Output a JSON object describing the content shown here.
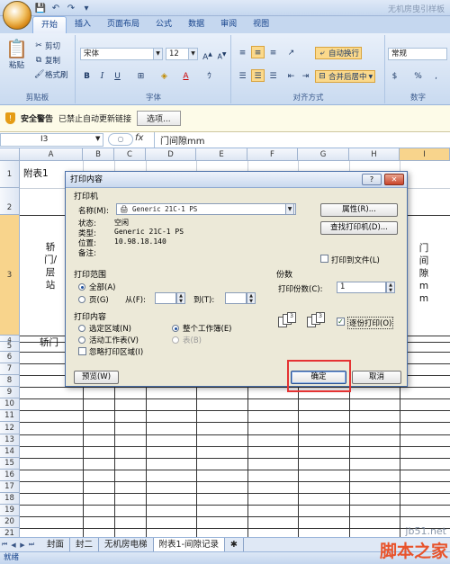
{
  "window": {
    "title": "无机房曳引样板"
  },
  "ribbon": {
    "tabs": [
      "开始",
      "插入",
      "页面布局",
      "公式",
      "数据",
      "审阅",
      "视图"
    ],
    "active_tab": "开始",
    "clipboard": {
      "paste": "粘贴",
      "cut": "剪切",
      "copy": "复制",
      "painter": "格式刷",
      "label": "剪贴板"
    },
    "font": {
      "name": "宋体",
      "size": "12",
      "label": "字体"
    },
    "alignment": {
      "wrap": "自动换行",
      "merge": "合并后居中",
      "label": "对齐方式"
    },
    "number": {
      "format": "常规",
      "label": "数字",
      "percent": "%",
      "comma": ","
    }
  },
  "security": {
    "title": "安全警告",
    "message": "已禁止自动更新链接",
    "options": "选项..."
  },
  "formula_bar": {
    "cell_ref": "I3",
    "fx": "fx",
    "content": "门间隙mm"
  },
  "grid": {
    "columns": [
      "A",
      "B",
      "C",
      "D",
      "E",
      "F",
      "G",
      "H",
      "I"
    ],
    "selected_column": "I",
    "selected_row": "3",
    "rows": [
      "1",
      "2",
      "3",
      "4",
      "5",
      "6",
      "7",
      "8",
      "9",
      "10",
      "11",
      "12",
      "13",
      "14",
      "15",
      "16",
      "17",
      "18",
      "19",
      "20",
      "21"
    ],
    "cells": {
      "a1": "附表1",
      "a3": "轿门/层站",
      "a5": "轿门",
      "i3": "门间隙mm"
    }
  },
  "sheets": {
    "tabs": [
      "封面",
      "封二",
      "无机房电梯",
      "附表1-间隙记录"
    ],
    "active": "附表1-间隙记录",
    "nav": [
      "⏮",
      "◀",
      "▶",
      "⏭"
    ]
  },
  "status": "就绪",
  "dialog": {
    "title": "打印内容",
    "help": "?",
    "close": "✕",
    "printer": {
      "section": "打印机",
      "name_label": "名称(M):",
      "name_value": "Generic 21C-1 PS",
      "status_label": "状态:",
      "status_value": "空闲",
      "type_label": "类型:",
      "type_value": "Generic 21C-1 PS",
      "where_label": "位置:",
      "where_value": "10.98.18.140",
      "comment_label": "备注:",
      "properties_btn": "属性(R)...",
      "find_btn": "查找打印机(D)...",
      "print_to_file": "打印到文件(L)"
    },
    "range": {
      "section": "打印范围",
      "all": "全部(A)",
      "pages": "页(G)",
      "from": "从(F):",
      "to": "到(T):"
    },
    "copies": {
      "section": "份数",
      "count_label": "打印份数(C):",
      "count_value": "1",
      "collate": "逐份打印(O)"
    },
    "content": {
      "section": "打印内容",
      "selection": "选定区域(N)",
      "whole_book": "整个工作簿(E)",
      "active_sheets": "活动工作表(V)",
      "table": "表(B)",
      "ignore_area": "忽略打印区域(I)"
    },
    "preview_btn": "预览(W)",
    "ok_btn": "确定",
    "cancel_btn": "取消"
  },
  "watermark": {
    "site": "jb51.net",
    "brand": "脚本之家"
  }
}
